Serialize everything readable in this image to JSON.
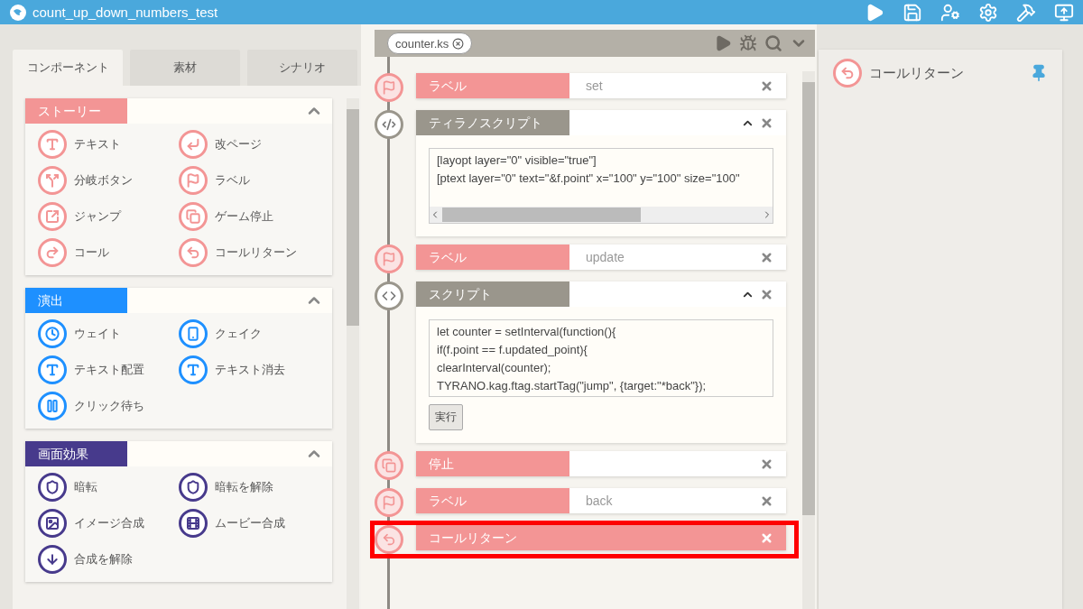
{
  "window": {
    "title": "count_up_down_numbers_test"
  },
  "left_panel": {
    "tabs": [
      {
        "label": "コンポーネント",
        "selected": true
      },
      {
        "label": "素材",
        "selected": false
      },
      {
        "label": "シナリオ",
        "selected": false
      }
    ],
    "categories": [
      {
        "title": "ストーリー",
        "color": "#f39595",
        "expanded": true,
        "items": [
          "テキスト",
          "改ページ",
          "分岐ボタン",
          "ラベル",
          "ジャンプ",
          "ゲーム停止",
          "コール",
          "コールリターン"
        ]
      },
      {
        "title": "演出",
        "color": "#1e90ff",
        "expanded": true,
        "items": [
          "ウェイト",
          "クェイク",
          "テキスト配置",
          "テキスト消去",
          "クリック待ち"
        ]
      },
      {
        "title": "画面効果",
        "color": "#473a8c",
        "expanded": true,
        "items": [
          "暗転",
          "暗転を解除",
          "イメージ合成",
          "ムービー合成",
          "合成を解除"
        ]
      }
    ]
  },
  "editor": {
    "file_tab": "counter.ks",
    "blocks": [
      {
        "kind": "label",
        "title": "ラベル",
        "value": "set",
        "highlighted": false
      },
      {
        "kind": "tyranoscript",
        "title": "ティラノスクリプト",
        "expanded": true,
        "highlighted": false,
        "code": [
          "[layopt layer=\"0\" visible=\"true\"]",
          "[ptext layer=\"0\" text=\"&f.point\" x=\"100\" y=\"100\" size=\"100\""
        ]
      },
      {
        "kind": "label",
        "title": "ラベル",
        "value": "update",
        "highlighted": false
      },
      {
        "kind": "script",
        "title": "スクリプト",
        "expanded": true,
        "highlighted": false,
        "code": [
          "let counter = setInterval(function(){",
          "if(f.point == f.updated_point){",
          "clearInterval(counter);",
          "TYRANO.kag.ftag.startTag(\"jump\", {target:\"*back\"});"
        ],
        "run_button": "実行"
      },
      {
        "kind": "stop",
        "title": "停止",
        "highlighted": false
      },
      {
        "kind": "label",
        "title": "ラベル",
        "value": "back",
        "highlighted": false
      },
      {
        "kind": "return",
        "title": "コールリターン",
        "highlighted": true
      }
    ]
  },
  "properties_panel": {
    "title": "コールリターン",
    "pinned": true
  }
}
